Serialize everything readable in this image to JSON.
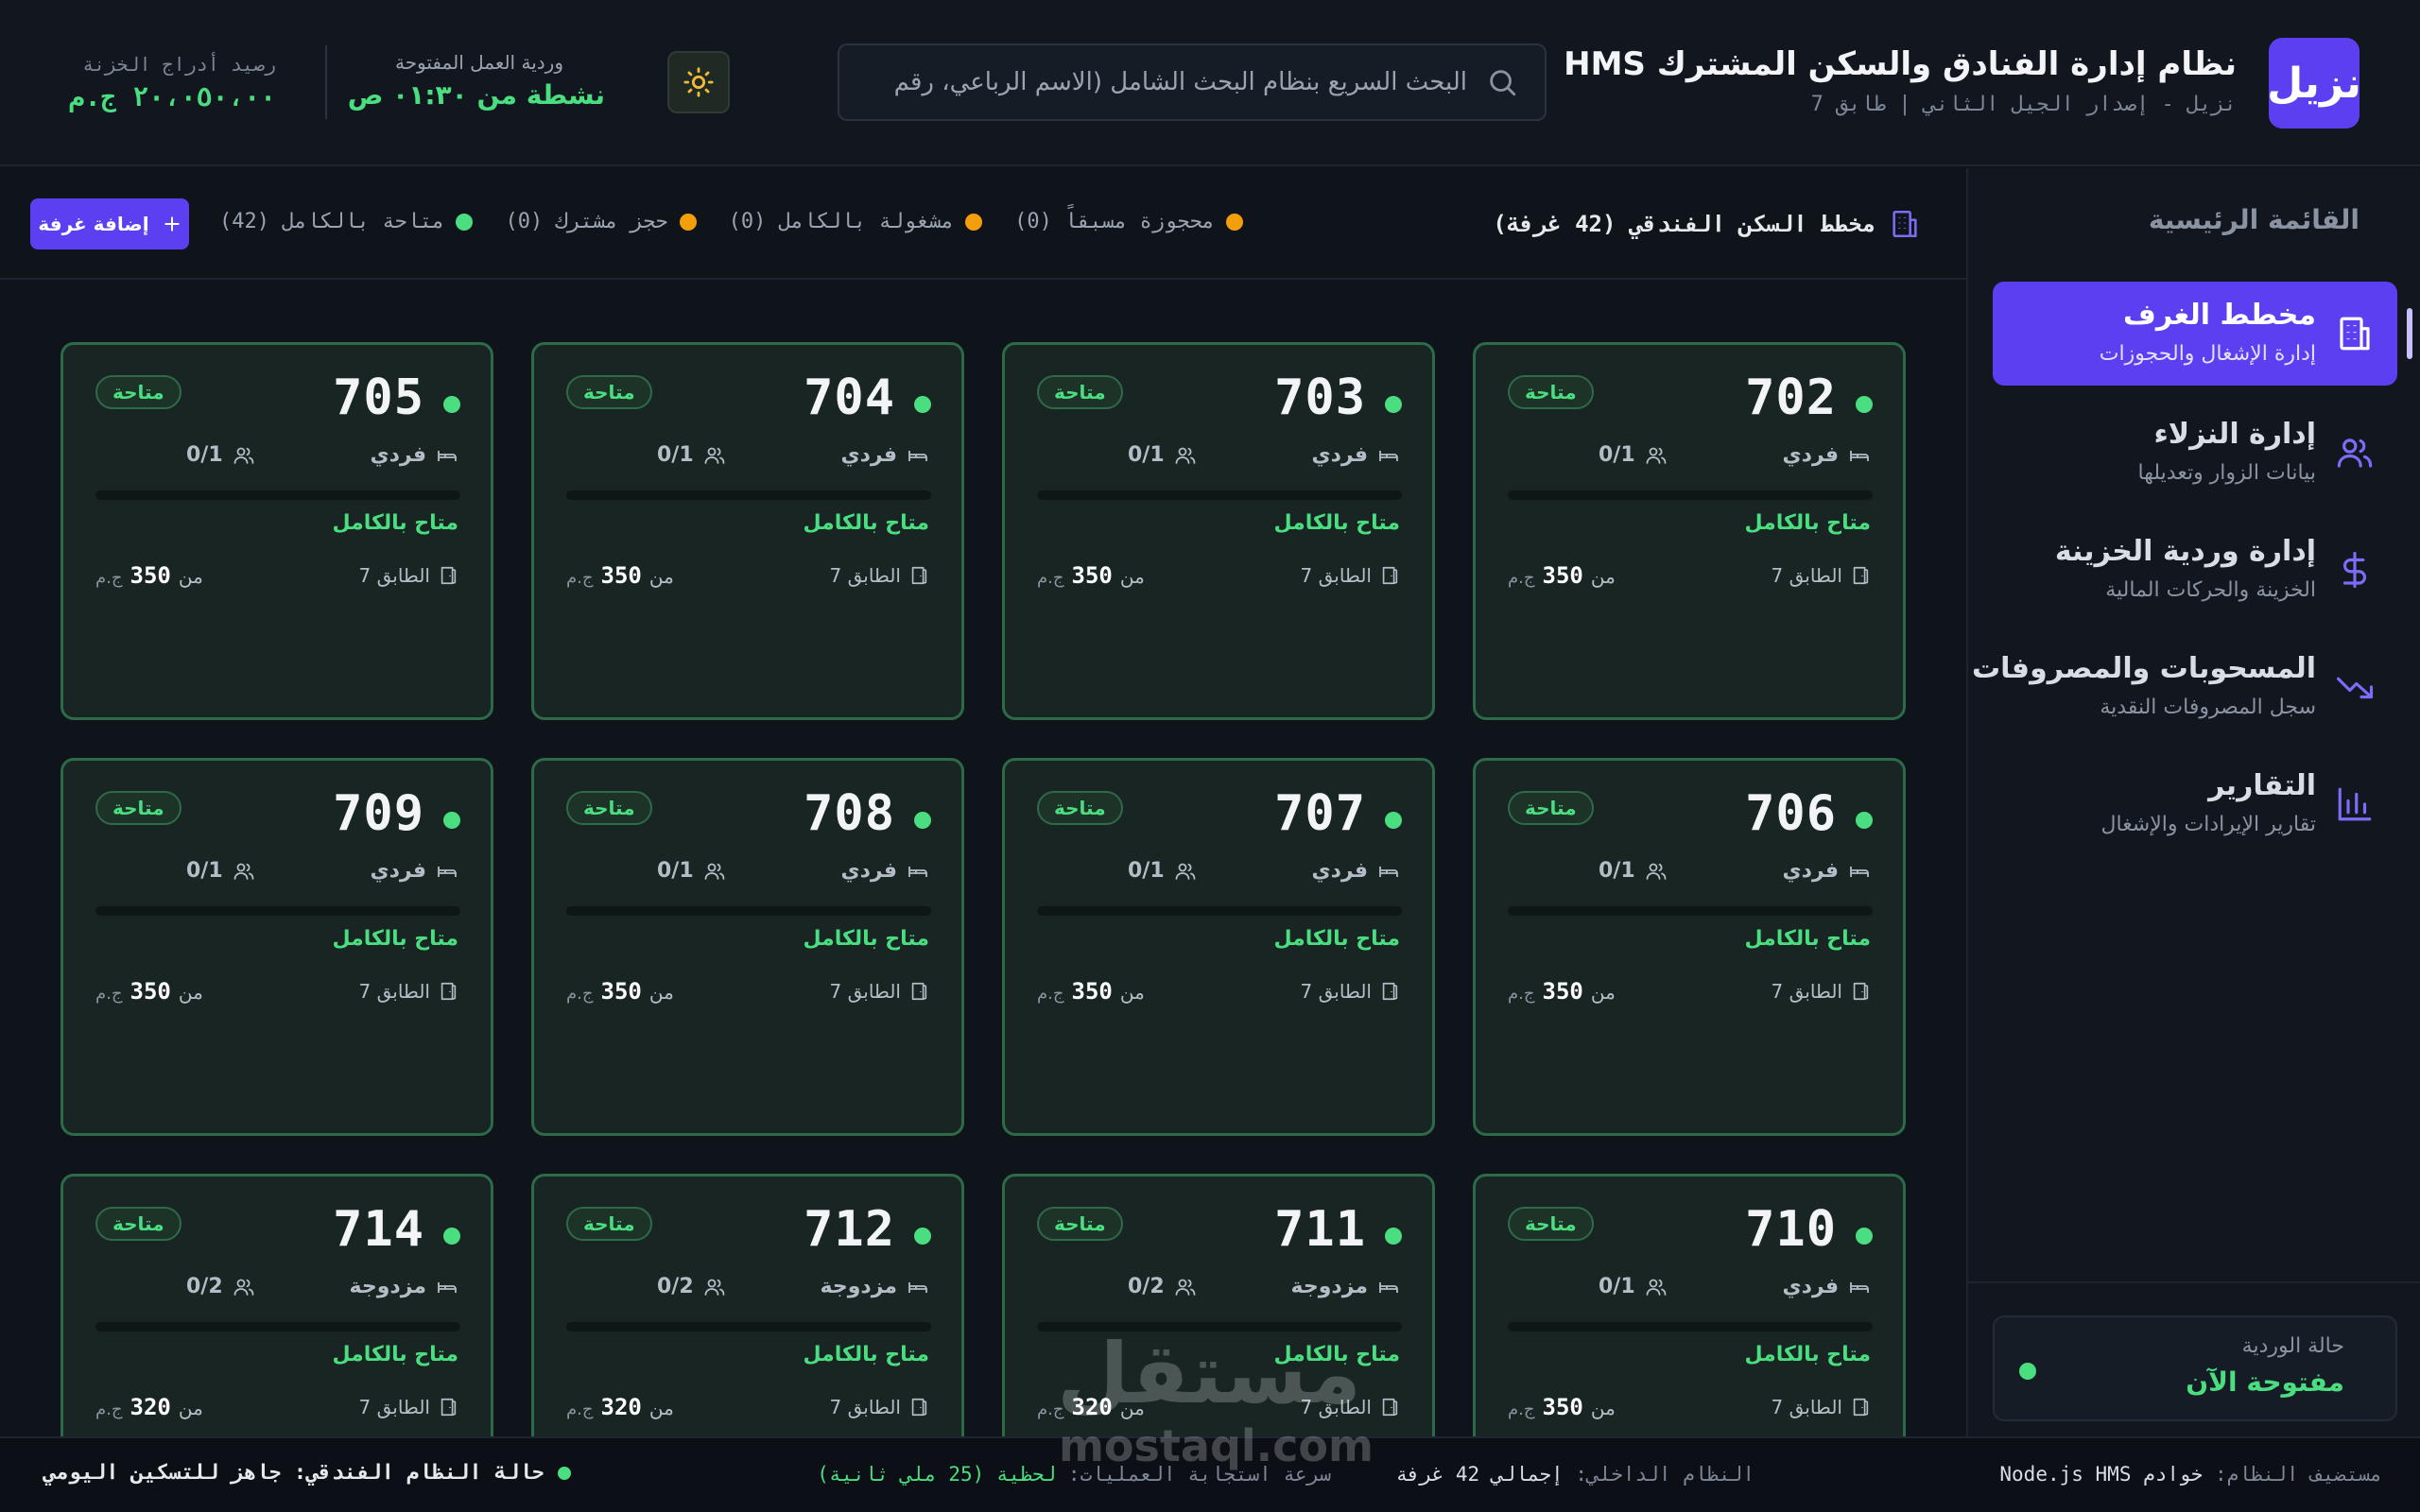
{
  "header": {
    "logo_text": "نزيل",
    "title": "نظام إدارة الفنادق والسكن المشترك HMS",
    "subtitle": "نزيل - إصدار الجيل الثاني | طابق 7",
    "search_placeholder": "البحث السريع بنظام البحث الشامل (الاسم الرباعي، رقم",
    "shift_label": "وردية العمل المفتوحة",
    "shift_status": "نشطة من ٠١:٣٠ ص",
    "treasury_label": "رصيد أدراج الخزنة",
    "treasury_value": "٢٠،٠٥٠،٠٠ ج.م"
  },
  "sidebar": {
    "heading": "القائمة الرئيسية",
    "items": [
      {
        "title": "مخطط الغرف",
        "subtitle": "إدارة الإشغال والحجوزات",
        "icon": "building-icon",
        "active": true
      },
      {
        "title": "إدارة النزلاء",
        "subtitle": "بيانات الزوار وتعديلها",
        "icon": "users-icon",
        "active": false
      },
      {
        "title": "إدارة وردية الخزينة",
        "subtitle": "الخزينة والحركات المالية",
        "icon": "dollar-icon",
        "active": false
      },
      {
        "title": "المسحوبات والمصروفات",
        "subtitle": "سجل المصروفات النقدية",
        "icon": "trending-down-icon",
        "active": false
      },
      {
        "title": "التقارير",
        "subtitle": "تقارير الإيرادات والإشغال",
        "icon": "bar-chart-icon",
        "active": false
      }
    ],
    "shift_box": {
      "label": "حالة الوردية",
      "value": "مفتوحة الآن"
    }
  },
  "toolbar": {
    "layout_title": "مخطط السكن الفندقي (42 غرفة)",
    "legend": [
      {
        "label": "متاحة بالكامل (42)",
        "color": "#4ade80"
      },
      {
        "label": "حجز مشترك (0)",
        "color": "#f59e0b"
      },
      {
        "label": "مشغولة بالكامل (0)",
        "color": "#f59e0b"
      },
      {
        "label": "محجوزة مسبقاً (0)",
        "color": "#f59e0b"
      }
    ],
    "add_room_label": "إضافة غرفة"
  },
  "rooms": [
    {
      "number": "702",
      "badge": "متاحة",
      "type": "فردي",
      "occupancy": "0/1",
      "status": "متاح بالكامل",
      "floor": "الطابق 7",
      "price_prefix": "من",
      "price": "350",
      "currency": "ج.م"
    },
    {
      "number": "703",
      "badge": "متاحة",
      "type": "فردي",
      "occupancy": "0/1",
      "status": "متاح بالكامل",
      "floor": "الطابق 7",
      "price_prefix": "من",
      "price": "350",
      "currency": "ج.م"
    },
    {
      "number": "704",
      "badge": "متاحة",
      "type": "فردي",
      "occupancy": "0/1",
      "status": "متاح بالكامل",
      "floor": "الطابق 7",
      "price_prefix": "من",
      "price": "350",
      "currency": "ج.م"
    },
    {
      "number": "705",
      "badge": "متاحة",
      "type": "فردي",
      "occupancy": "0/1",
      "status": "متاح بالكامل",
      "floor": "الطابق 7",
      "price_prefix": "من",
      "price": "350",
      "currency": "ج.م"
    },
    {
      "number": "706",
      "badge": "متاحة",
      "type": "فردي",
      "occupancy": "0/1",
      "status": "متاح بالكامل",
      "floor": "الطابق 7",
      "price_prefix": "من",
      "price": "350",
      "currency": "ج.م"
    },
    {
      "number": "707",
      "badge": "متاحة",
      "type": "فردي",
      "occupancy": "0/1",
      "status": "متاح بالكامل",
      "floor": "الطابق 7",
      "price_prefix": "من",
      "price": "350",
      "currency": "ج.م"
    },
    {
      "number": "708",
      "badge": "متاحة",
      "type": "فردي",
      "occupancy": "0/1",
      "status": "متاح بالكامل",
      "floor": "الطابق 7",
      "price_prefix": "من",
      "price": "350",
      "currency": "ج.م"
    },
    {
      "number": "709",
      "badge": "متاحة",
      "type": "فردي",
      "occupancy": "0/1",
      "status": "متاح بالكامل",
      "floor": "الطابق 7",
      "price_prefix": "من",
      "price": "350",
      "currency": "ج.م"
    },
    {
      "number": "710",
      "badge": "متاحة",
      "type": "فردي",
      "occupancy": "0/1",
      "status": "متاح بالكامل",
      "floor": "الطابق 7",
      "price_prefix": "من",
      "price": "350",
      "currency": "ج.م"
    },
    {
      "number": "711",
      "badge": "متاحة",
      "type": "مزدوجة",
      "occupancy": "0/2",
      "status": "متاح بالكامل",
      "floor": "الطابق 7",
      "price_prefix": "من",
      "price": "320",
      "currency": "ج.م"
    },
    {
      "number": "712",
      "badge": "متاحة",
      "type": "مزدوجة",
      "occupancy": "0/2",
      "status": "متاح بالكامل",
      "floor": "الطابق 7",
      "price_prefix": "من",
      "price": "320",
      "currency": "ج.م"
    },
    {
      "number": "714",
      "badge": "متاحة",
      "type": "مزدوجة",
      "occupancy": "0/2",
      "status": "متاح بالكامل",
      "floor": "الطابق 7",
      "price_prefix": "من",
      "price": "320",
      "currency": "ج.م"
    }
  ],
  "footer": {
    "server_label": "مستضيف النظام:",
    "server_value": "خوادم Node.js HMS",
    "internal_label": "النظام الداخلي:",
    "internal_value": "إجمالي 42 غرفة",
    "speed_label": "سرعة استجابة العمليات:",
    "speed_value": "لحظية (25 ملي ثانية)",
    "status": "حالة النظام الفندقي: جاهز للتسكين اليومي"
  },
  "watermark": {
    "arabic": "مستقل",
    "latin": "mostaql.com"
  }
}
